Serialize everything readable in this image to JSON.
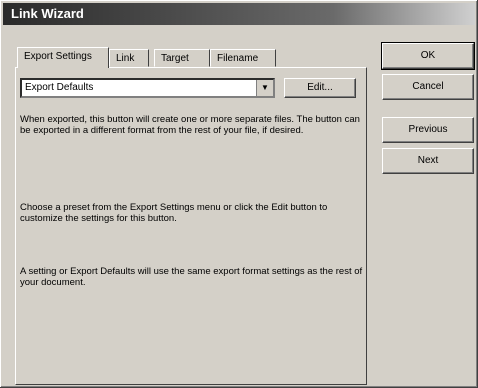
{
  "window": {
    "title": "Link Wizard"
  },
  "tabs": [
    {
      "label": "Export Settings"
    },
    {
      "label": "Link"
    },
    {
      "label": "Target"
    },
    {
      "label": "Filename"
    }
  ],
  "export_select": {
    "value": "Export Defaults"
  },
  "buttons": {
    "edit": "Edit...",
    "ok": "OK",
    "cancel": "Cancel",
    "previous": "Previous",
    "next": "Next"
  },
  "descriptions": [
    "When exported, this button will create one or more separate files. The button can be exported in a different format from the rest of your file, if desired.",
    "Choose a preset from the Export Settings menu or click the Edit button to customize the settings for this button.",
    "A setting or Export Defaults will use the same export format settings as the rest of your document."
  ]
}
